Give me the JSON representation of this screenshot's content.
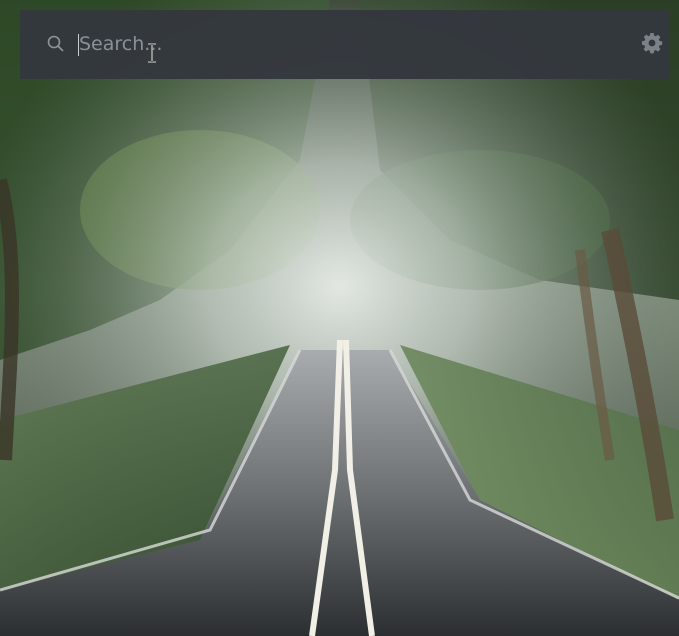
{
  "background": {
    "icon": "forest-road-wallpaper"
  },
  "searchbar": {
    "value": "",
    "placeholder": "Search...",
    "icons": {
      "left": "search-icon",
      "right": "gear-icon",
      "cursor": "text-cursor-icon"
    },
    "bg_color": "#34383e",
    "text_color": "#8b9098"
  }
}
